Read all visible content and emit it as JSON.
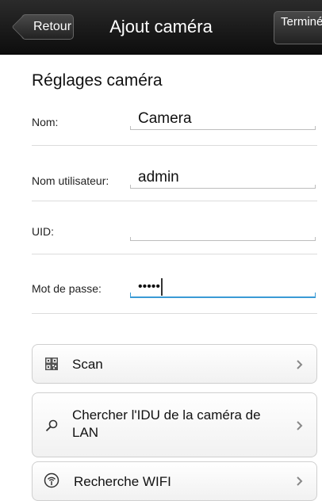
{
  "header": {
    "back_label": "Retour",
    "title": "Ajout caméra",
    "done_label": "Terminé"
  },
  "settings": {
    "section_title": "Réglages caméra",
    "fields": [
      {
        "label": "Nom:",
        "value": "Camera"
      },
      {
        "label": "Nom utilisateur:",
        "value": "admin"
      },
      {
        "label": "UID:",
        "value": ""
      },
      {
        "label": "Mot de passe:",
        "value": "•••••",
        "focused": true
      }
    ]
  },
  "actions": [
    {
      "label": "Scan",
      "icon": "qr-code-icon"
    },
    {
      "label": "Chercher l'IDU de la caméra de LAN",
      "icon": "search-icon"
    },
    {
      "label": "Recherche WIFI",
      "icon": "wifi-icon"
    }
  ],
  "colors": {
    "header_bg": "#1a1a1a",
    "focus_accent": "#3a9bd5",
    "divider": "#dcdcdc"
  }
}
